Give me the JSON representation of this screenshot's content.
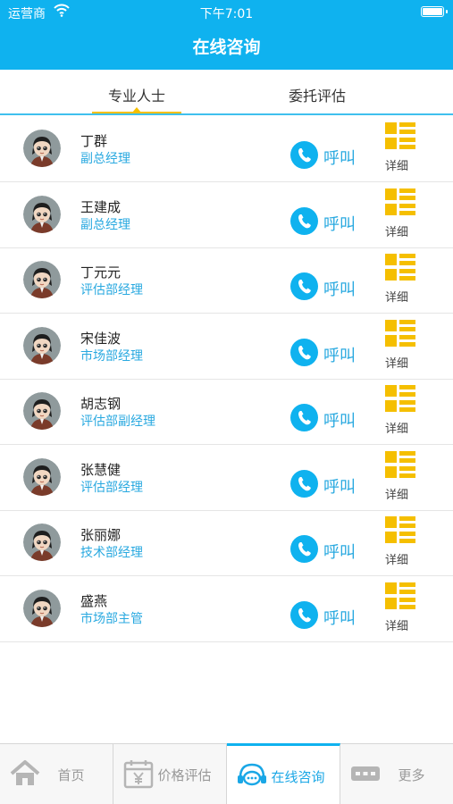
{
  "status_bar": {
    "carrier": "运营商",
    "time": "下午7:01"
  },
  "header": {
    "title": "在线咨询"
  },
  "tabs": [
    {
      "label": "专业人士",
      "active": true
    },
    {
      "label": "委托评估",
      "active": false
    }
  ],
  "people": [
    {
      "name": "丁群",
      "title": "副总经理",
      "call_label": "呼叫",
      "detail_label": "详细"
    },
    {
      "name": "王建成",
      "title": "副总经理",
      "call_label": "呼叫",
      "detail_label": "详细"
    },
    {
      "name": "丁元元",
      "title": "评估部经理",
      "call_label": "呼叫",
      "detail_label": "详细"
    },
    {
      "name": "宋佳波",
      "title": "市场部经理",
      "call_label": "呼叫",
      "detail_label": "详细"
    },
    {
      "name": "胡志钢",
      "title": "评估部副经理",
      "call_label": "呼叫",
      "detail_label": "详细"
    },
    {
      "name": "张慧健",
      "title": "评估部经理",
      "call_label": "呼叫",
      "detail_label": "详细"
    },
    {
      "name": "张丽娜",
      "title": "技术部经理",
      "call_label": "呼叫",
      "detail_label": "详细"
    },
    {
      "name": "盛燕",
      "title": "市场部主管",
      "call_label": "呼叫",
      "detail_label": "详细"
    }
  ],
  "bottom_tabs": [
    {
      "label": "首页",
      "icon": "home-icon",
      "active": false
    },
    {
      "label": "价格评估",
      "icon": "calendar-yen-icon",
      "active": false
    },
    {
      "label": "在线咨询",
      "icon": "chat-headset-icon",
      "active": true
    },
    {
      "label": "更多",
      "icon": "more-dots-icon",
      "active": false
    }
  ],
  "colors": {
    "primary": "#0fb2ef",
    "accent_yellow": "#f5bf00",
    "link_blue": "#29a9e0"
  }
}
